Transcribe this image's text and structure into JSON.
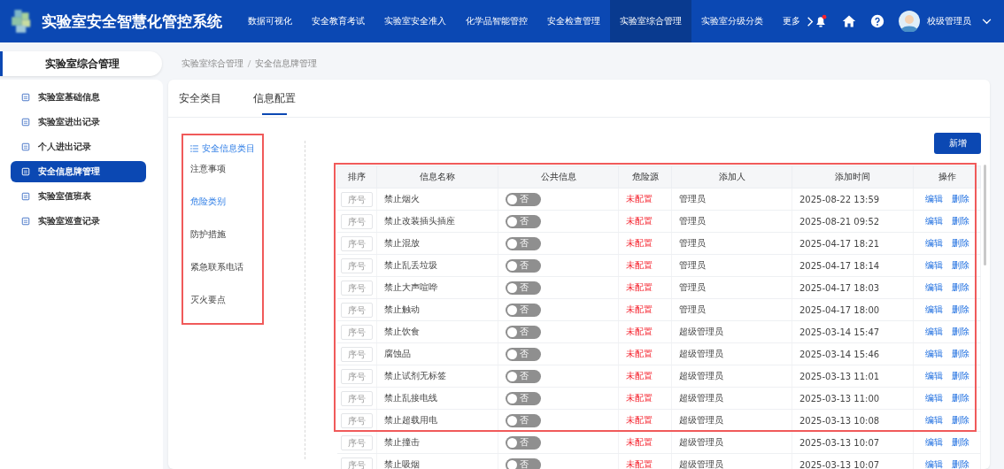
{
  "header": {
    "title": "实验室安全智慧化管控系统",
    "nav": [
      {
        "label": "数据可视化",
        "selected": false
      },
      {
        "label": "安全教育考试",
        "selected": false
      },
      {
        "label": "实验室安全准入",
        "selected": false
      },
      {
        "label": "化学品智能管控",
        "selected": false
      },
      {
        "label": "安全检查管理",
        "selected": false
      },
      {
        "label": "实验室综合管理",
        "selected": true
      },
      {
        "label": "实验室分级分类",
        "selected": false
      },
      {
        "label": "更多",
        "selected": false
      }
    ],
    "has_notification": true,
    "user": "校级管理员"
  },
  "sidebar": {
    "title": "实验室综合管理",
    "items": [
      {
        "label": "实验室基础信息",
        "selected": false
      },
      {
        "label": "实验室进出记录",
        "selected": false
      },
      {
        "label": "个人进出记录",
        "selected": false
      },
      {
        "label": "安全信息牌管理",
        "selected": true
      },
      {
        "label": "实验室值班表",
        "selected": false
      },
      {
        "label": "实验室巡查记录",
        "selected": false
      }
    ]
  },
  "breadcrumb": [
    "实验室综合管理",
    "安全信息牌管理"
  ],
  "tabs": [
    {
      "label": "安全类目",
      "selected": false
    },
    {
      "label": "信息配置",
      "selected": true
    }
  ],
  "category": {
    "title": "安全信息类目",
    "items": [
      {
        "label": "注意事项",
        "selected": false
      },
      {
        "label": "危险类别",
        "selected": true
      },
      {
        "label": "防护措施",
        "selected": false
      },
      {
        "label": "紧急联系电话",
        "selected": false
      },
      {
        "label": "灭火要点",
        "selected": false
      }
    ]
  },
  "add_button": "新增",
  "table": {
    "columns": [
      "排序",
      "信息名称",
      "公共信息",
      "危险源",
      "添加人",
      "添加时间",
      "操作"
    ],
    "rows": [
      {
        "order_placeholder": "序号",
        "name": "禁止烟火",
        "public": {
          "on": false,
          "label": "否"
        },
        "hazard": "未配置",
        "adder": "管理员",
        "time": "2025-08-22 13:59",
        "actions": [
          "编辑",
          "删除"
        ]
      },
      {
        "order_placeholder": "序号",
        "name": "禁止改装插头插座",
        "public": {
          "on": false,
          "label": "否"
        },
        "hazard": "未配置",
        "adder": "管理员",
        "time": "2025-08-21 09:52",
        "actions": [
          "编辑",
          "删除"
        ]
      },
      {
        "order_placeholder": "序号",
        "name": "禁止混放",
        "public": {
          "on": false,
          "label": "否"
        },
        "hazard": "未配置",
        "adder": "管理员",
        "time": "2025-04-17 18:21",
        "actions": [
          "编辑",
          "删除"
        ]
      },
      {
        "order_placeholder": "序号",
        "name": "禁止乱丢垃圾",
        "public": {
          "on": false,
          "label": "否"
        },
        "hazard": "未配置",
        "adder": "管理员",
        "time": "2025-04-17 18:14",
        "actions": [
          "编辑",
          "删除"
        ]
      },
      {
        "order_placeholder": "序号",
        "name": "禁止大声喧哗",
        "public": {
          "on": false,
          "label": "否"
        },
        "hazard": "未配置",
        "adder": "管理员",
        "time": "2025-04-17 18:03",
        "actions": [
          "编辑",
          "删除"
        ]
      },
      {
        "order_placeholder": "序号",
        "name": "禁止触动",
        "public": {
          "on": false,
          "label": "否"
        },
        "hazard": "未配置",
        "adder": "管理员",
        "time": "2025-04-17 18:00",
        "actions": [
          "编辑",
          "删除"
        ]
      },
      {
        "order_placeholder": "序号",
        "name": "禁止饮食",
        "public": {
          "on": false,
          "label": "否"
        },
        "hazard": "未配置",
        "adder": "超级管理员",
        "time": "2025-03-14 15:47",
        "actions": [
          "编辑",
          "删除"
        ]
      },
      {
        "order_placeholder": "序号",
        "name": "腐蚀品",
        "public": {
          "on": false,
          "label": "否"
        },
        "hazard": "未配置",
        "adder": "超级管理员",
        "time": "2025-03-14 15:46",
        "actions": [
          "编辑",
          "删除"
        ]
      },
      {
        "order_placeholder": "序号",
        "name": "禁止试剂无标签",
        "public": {
          "on": false,
          "label": "否"
        },
        "hazard": "未配置",
        "adder": "超级管理员",
        "time": "2025-03-13 11:01",
        "actions": [
          "编辑",
          "删除"
        ]
      },
      {
        "order_placeholder": "序号",
        "name": "禁止乱接电线",
        "public": {
          "on": false,
          "label": "否"
        },
        "hazard": "未配置",
        "adder": "超级管理员",
        "time": "2025-03-13 11:00",
        "actions": [
          "编辑",
          "删除"
        ]
      },
      {
        "order_placeholder": "序号",
        "name": "禁止超载用电",
        "public": {
          "on": false,
          "label": "否"
        },
        "hazard": "未配置",
        "adder": "超级管理员",
        "time": "2025-03-13 10:08",
        "actions": [
          "编辑",
          "删除"
        ]
      },
      {
        "order_placeholder": "序号",
        "name": "禁止撞击",
        "public": {
          "on": false,
          "label": "否"
        },
        "hazard": "未配置",
        "adder": "超级管理员",
        "time": "2025-03-13 10:07",
        "actions": [
          "编辑",
          "删除"
        ]
      },
      {
        "order_placeholder": "序号",
        "name": "禁止吸烟",
        "public": {
          "on": false,
          "label": "否"
        },
        "hazard": "未配置",
        "adder": "超级管理员",
        "time": "2025-03-13 10:07",
        "actions": [
          "编辑",
          "删除"
        ]
      }
    ]
  }
}
